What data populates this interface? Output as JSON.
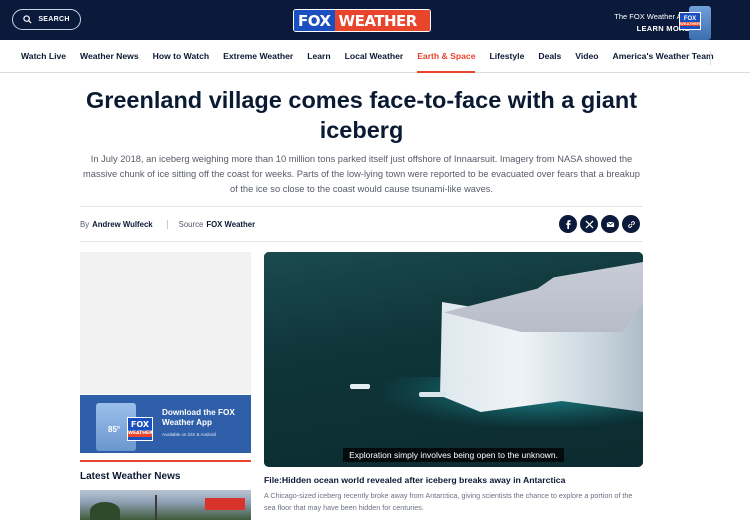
{
  "header": {
    "search_label": "SEARCH",
    "logo": {
      "part1": "FOX",
      "part2": "WEATHER"
    },
    "app_promo": {
      "line1": "The FOX Weather App",
      "line2": "LEARN MORE"
    },
    "app_badge": {
      "part1": "FOX",
      "part2": "WEATHER"
    }
  },
  "nav": {
    "items": [
      {
        "label": "Watch Live"
      },
      {
        "label": "Weather News"
      },
      {
        "label": "How to Watch"
      },
      {
        "label": "Extreme Weather"
      },
      {
        "label": "Learn"
      },
      {
        "label": "Local Weather"
      },
      {
        "label": "Earth & Space"
      },
      {
        "label": "Lifestyle"
      },
      {
        "label": "Deals"
      },
      {
        "label": "Video"
      },
      {
        "label": "America's Weather Team"
      }
    ],
    "active": "Earth & Space"
  },
  "article": {
    "headline": "Greenland village comes face-to-face with a giant iceberg",
    "dek": "In July 2018, an iceberg weighing more than 10 million tons parked itself just offshore of Innaarsuit. Imagery from NASA showed the massive chunk of ice sitting off the coast for weeks. Parts of the low-lying town were reported to be evacuated over fears that a breakup of the ice so close to the coast would cause tsunami-like waves.",
    "byline_prefix": "By",
    "author": "Andrew Wulfeck",
    "source_prefix": "Source",
    "source": "FOX Weather"
  },
  "share": {
    "icons": [
      "facebook-icon",
      "x-icon",
      "email-icon",
      "link-icon"
    ]
  },
  "sidebar": {
    "promo": {
      "temp": "85°",
      "badge1": "FOX",
      "badge2": "WEATHER",
      "title": "Download the FOX Weather App",
      "subtitle": "Available on iOS & Android"
    },
    "latest_title": "Latest Weather News"
  },
  "video": {
    "caption": "Exploration simply involves being open to the unknown.",
    "title": "File:Hidden ocean world revealed after iceberg breaks away in Antarctica",
    "description": "A Chicago-sized iceberg recently broke away from Antarctica, giving scientists the chance to explore a portion of the sea floor that may have been hidden for centuries."
  },
  "colors": {
    "header_bg": "#0b1a3a",
    "accent": "#e8452c",
    "brand_blue": "#1a4fbf",
    "text": "#0b1a33"
  }
}
